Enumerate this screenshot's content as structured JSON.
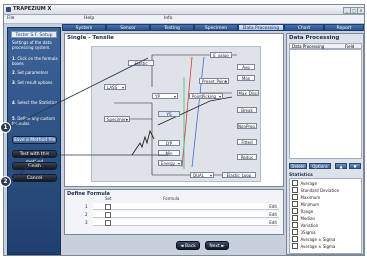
{
  "window": {
    "title": "TRAPEZIUM X"
  },
  "menu": [
    "File",
    "Help",
    "Info"
  ],
  "tabs": [
    {
      "label": "System",
      "active": false
    },
    {
      "label": "Sensor",
      "active": false
    },
    {
      "label": "Testing",
      "active": false
    },
    {
      "label": "Specimen",
      "active": false
    },
    {
      "label": "Data Processing",
      "active": true
    },
    {
      "label": "Chart",
      "active": false
    },
    {
      "label": "Report",
      "active": false
    }
  ],
  "sidebar": {
    "header": "Tester S.F. Setup",
    "description": "Settings of the data processing system.",
    "steps": [
      {
        "num": "1",
        "text": "Click on the formula boxes"
      },
      {
        "num": "2",
        "text": "Set parameters"
      },
      {
        "num": "3",
        "text": "Set result options"
      },
      {
        "num": "4",
        "text": "Select the Statistics"
      },
      {
        "num": "5",
        "text": "Define any custom formulas"
      }
    ],
    "buttons": [
      "Save a Method file",
      "Test with this method",
      "Finish",
      "Cancel"
    ]
  },
  "main": {
    "title": "Single - Tensile",
    "boxes": {
      "elastic": "Elastic",
      "e_value": "E_value",
      "avg": "Avg",
      "max": "Max",
      "lass": "LASS",
      "preset_point": "Preset_Point",
      "yp": "YP",
      "point_pick": "PointPicking",
      "max_disp": "Max_Disp",
      "specimen": "Specimen",
      "ys": "YS",
      "break": "Break",
      "non_prop": "NonProp.",
      "lyp": "LYP",
      "fitted": "Fitted",
      "min": "Min",
      "energy": "Energy",
      "reduc": "Reduc",
      "dual": "DUAL",
      "elastic_loop": "Elastic_Loop"
    }
  },
  "formula": {
    "title": "Define Formula",
    "columns": [
      "Set",
      "Formula"
    ],
    "rows": [
      {
        "num": "1",
        "edit": "Edit"
      },
      {
        "num": "2",
        "edit": "Edit"
      },
      {
        "num": "3",
        "edit": "Edit"
      }
    ]
  },
  "nav": {
    "back": "◄ Back",
    "next": "Next ►"
  },
  "data_processing": {
    "title": "Data Processing",
    "columns": [
      "Data Processing",
      "Field"
    ],
    "buttons": [
      "Delete",
      "Options",
      "▲",
      "▼"
    ],
    "stats_label": "Statistics",
    "stats": [
      "Average",
      "Standard Deviation",
      "Maximum",
      "Minimum",
      "Range",
      "Median",
      "Variation",
      "3Sigma",
      "Average    ±    Sigma",
      "Average    ±    Sigma"
    ]
  },
  "callouts": [
    "1",
    "2"
  ]
}
